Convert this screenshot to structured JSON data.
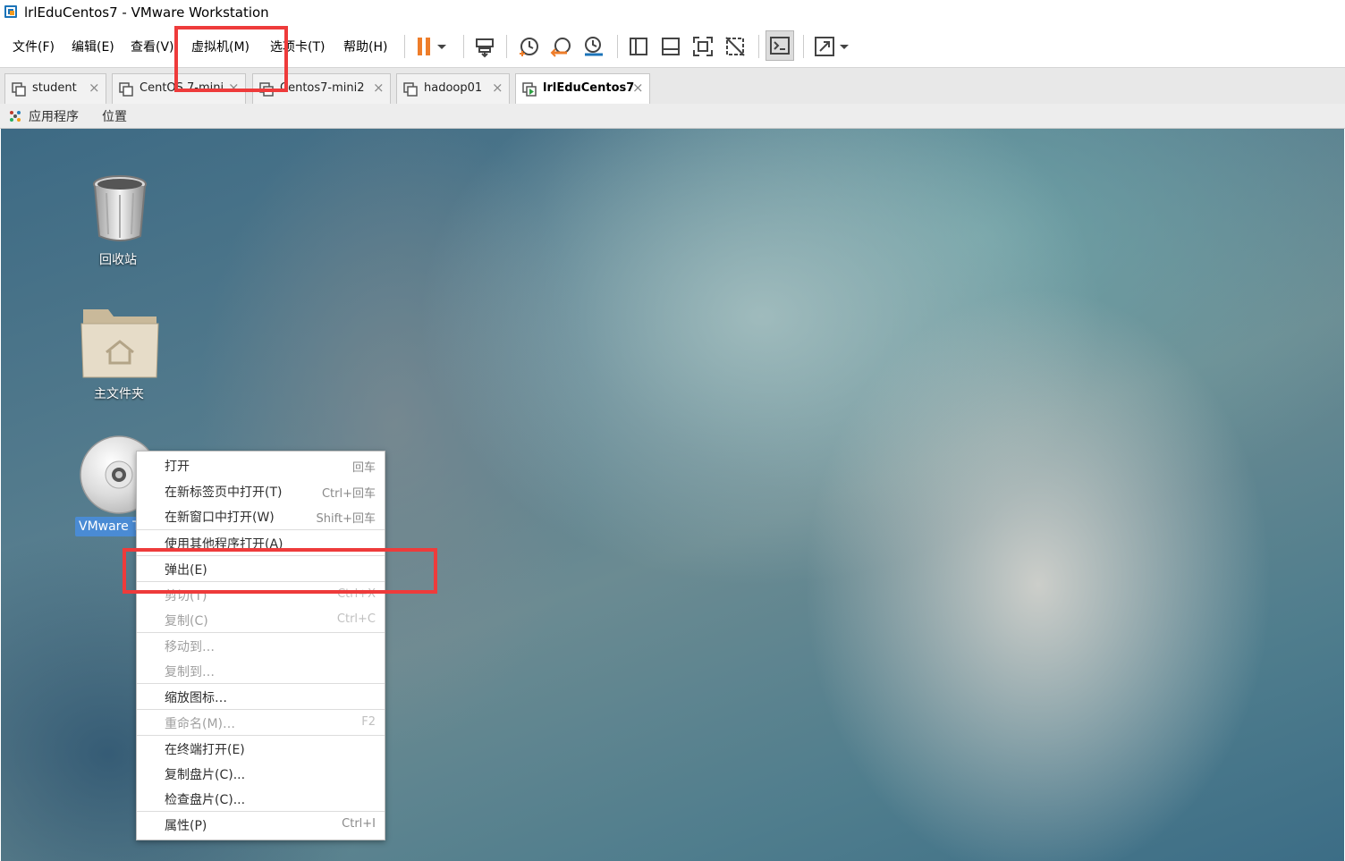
{
  "window": {
    "title": "lrlEduCentos7 - VMware Workstation"
  },
  "menubar": {
    "items": [
      {
        "label": "文件(F)"
      },
      {
        "label": "编辑(E)"
      },
      {
        "label": "查看(V)"
      },
      {
        "label": "虚拟机(M)"
      },
      {
        "label": "选项卡(T)"
      },
      {
        "label": "帮助(H)"
      }
    ]
  },
  "toolbar": {
    "icons": [
      "pause-icon",
      "dropdown-icon",
      "send-keys-icon",
      "snapshot-icon",
      "revert-snapshot-icon",
      "snapshot-manager-icon",
      "library-view-icon",
      "thumbnail-view-icon",
      "fullscreen-icon",
      "unity-icon",
      "console-icon",
      "stretch-view-icon",
      "dropdown-icon"
    ],
    "accent": "#ee7d2a"
  },
  "tabs": [
    {
      "label": "student",
      "active": false
    },
    {
      "label": "CentOS 7-mini",
      "active": false
    },
    {
      "label": "Centos7-mini2",
      "active": false
    },
    {
      "label": "hadoop01",
      "active": false
    },
    {
      "label": "lrlEduCentos7",
      "active": true
    }
  ],
  "gnome_panel": {
    "applications": "应用程序",
    "places": "位置"
  },
  "desktop": {
    "icons": [
      {
        "label": "回收站",
        "icon": "trash-icon"
      },
      {
        "label": "主文件夹",
        "icon": "home-folder-icon"
      },
      {
        "label": "VMware T",
        "icon": "cd-disc-icon",
        "selected": true
      }
    ]
  },
  "context_menu": {
    "items": [
      {
        "label": "打开",
        "accel": "回车",
        "enabled": true
      },
      {
        "label": "在新标签页中打开(T)",
        "accel": "Ctrl+回车",
        "enabled": true
      },
      {
        "label": "在新窗口中打开(W)",
        "accel": "Shift+回车",
        "enabled": true
      },
      {
        "label": "使用其他程序打开(A)",
        "accel": "",
        "enabled": true
      },
      {
        "label": "弹出(E)",
        "accel": "",
        "enabled": true
      },
      {
        "label": "剪切(T)",
        "accel": "Ctrl+X",
        "enabled": false
      },
      {
        "label": "复制(C)",
        "accel": "Ctrl+C",
        "enabled": false
      },
      {
        "label": "移动到…",
        "accel": "",
        "enabled": false
      },
      {
        "label": "复制到…",
        "accel": "",
        "enabled": false
      },
      {
        "label": "缩放图标…",
        "accel": "",
        "enabled": true
      },
      {
        "label": "重命名(M)…",
        "accel": "F2",
        "enabled": false
      },
      {
        "label": "在终端打开(E)",
        "accel": "",
        "enabled": true
      },
      {
        "label": "复制盘片(C)...",
        "accel": "",
        "enabled": true
      },
      {
        "label": "检查盘片(C)...",
        "accel": "",
        "enabled": true
      },
      {
        "label": "属性(P)",
        "accel": "Ctrl+I",
        "enabled": true
      }
    ]
  },
  "annotation_color": "#ee3b3b"
}
